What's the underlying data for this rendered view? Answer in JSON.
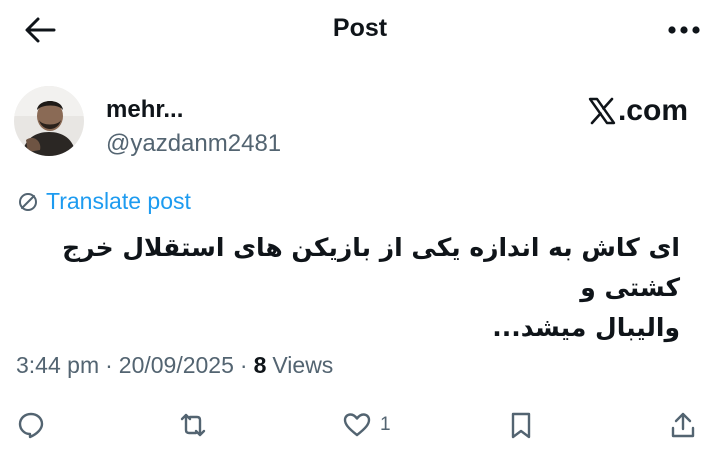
{
  "header": {
    "title": "Post",
    "back_icon": "arrow-left-icon",
    "more_icon": "more-horizontal-icon"
  },
  "author": {
    "name": "mehr...",
    "handle": "@yazdanm2481",
    "avatar_icon": "user-avatar"
  },
  "brand": {
    "label": ".com",
    "icon": "x-logo-icon"
  },
  "translate": {
    "label": "Translate post",
    "icon": "globe-icon"
  },
  "post": {
    "line1": "ای کاش به اندازه یکی از بازیکن های استقلال خرج کشتی و",
    "line2": "والیبال میشد..."
  },
  "meta": {
    "time": "3:44 pm",
    "date": "20/09/2025",
    "separator": "·",
    "views_count": "8",
    "views_label": "Views"
  },
  "actions": {
    "reply_icon": "reply-icon",
    "retweet_icon": "retweet-icon",
    "like_icon": "heart-icon",
    "like_count": "1",
    "bookmark_icon": "bookmark-icon",
    "share_icon": "share-icon"
  },
  "colors": {
    "accent": "#1d9bf0",
    "text": "#0f1419",
    "muted": "#536471"
  }
}
